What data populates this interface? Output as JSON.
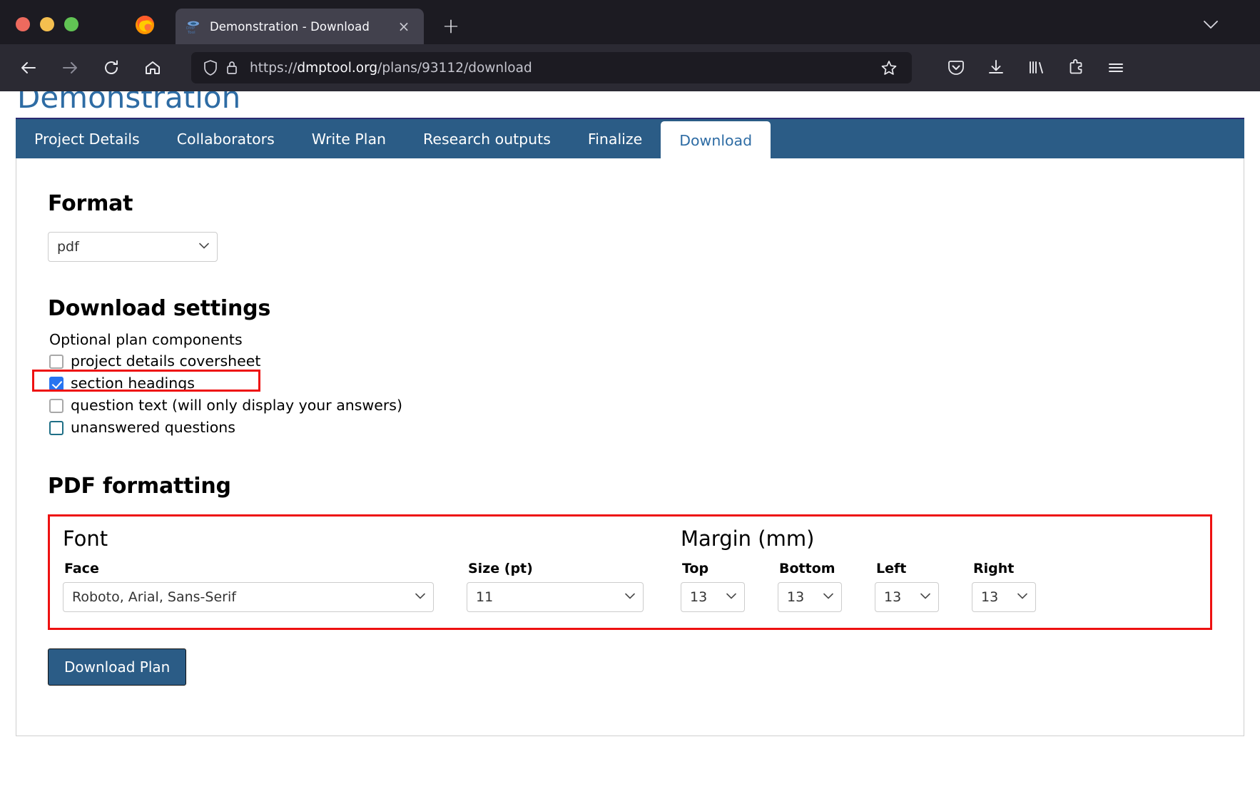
{
  "browser": {
    "window_controls": [
      "close",
      "minimize",
      "maximize"
    ],
    "app_icon": "firefox-icon",
    "tab": {
      "title": "Demonstration - Download",
      "favicon": "dmptool-favicon",
      "close_label": "×"
    },
    "new_tab_label": "+",
    "window_chevron": "∨",
    "toolbar": {
      "back": "back-arrow",
      "forward": "forward-arrow",
      "reload": "reload-icon",
      "home": "home-icon",
      "shield": "shield-icon",
      "lock": "lock-icon",
      "url_prefix": "https://",
      "url_host": "dmptool.org",
      "url_path": "/plans/93112/download",
      "url_full": "https://dmptool.org/plans/93112/download",
      "bookmark": "star-icon",
      "pocket": "pocket-icon",
      "downloads": "download-icon",
      "library": "library-icon",
      "extensions": "extension-icon",
      "menu": "hamburger-menu-icon"
    }
  },
  "page": {
    "title": "Demonstration",
    "tabs": [
      {
        "label": "Project Details",
        "active": false
      },
      {
        "label": "Collaborators",
        "active": false
      },
      {
        "label": "Write Plan",
        "active": false
      },
      {
        "label": "Research outputs",
        "active": false
      },
      {
        "label": "Finalize",
        "active": false
      },
      {
        "label": "Download",
        "active": true
      }
    ],
    "format": {
      "heading": "Format",
      "selected": "pdf",
      "chevron": "∨"
    },
    "download_settings": {
      "heading": "Download settings",
      "optional_label": "Optional plan components",
      "components": [
        {
          "label": "project details coversheet",
          "checked": false,
          "focused": false
        },
        {
          "label": "section headings",
          "checked": true,
          "focused": false
        },
        {
          "label": "question text (will only display your answers)",
          "checked": false,
          "focused": false
        },
        {
          "label": "unanswered questions",
          "checked": false,
          "focused": true
        }
      ]
    },
    "pdf_formatting": {
      "heading": "PDF formatting",
      "font": {
        "heading": "Font",
        "face_label": "Face",
        "face_value": "Roboto, Arial, Sans-Serif",
        "size_label": "Size (pt)",
        "size_value": "11"
      },
      "margin": {
        "heading": "Margin (mm)",
        "fields": [
          {
            "label": "Top",
            "value": "13"
          },
          {
            "label": "Bottom",
            "value": "13"
          },
          {
            "label": "Left",
            "value": "13"
          },
          {
            "label": "Right",
            "value": "13"
          }
        ]
      }
    },
    "download_button": "Download Plan"
  },
  "colors": {
    "accent_blue": "#2b5c86",
    "link_blue": "#2e6ca4",
    "highlight_red": "#ee1111",
    "checkbox_blue": "#2874f0",
    "chrome_dark": "#2b2a33"
  }
}
